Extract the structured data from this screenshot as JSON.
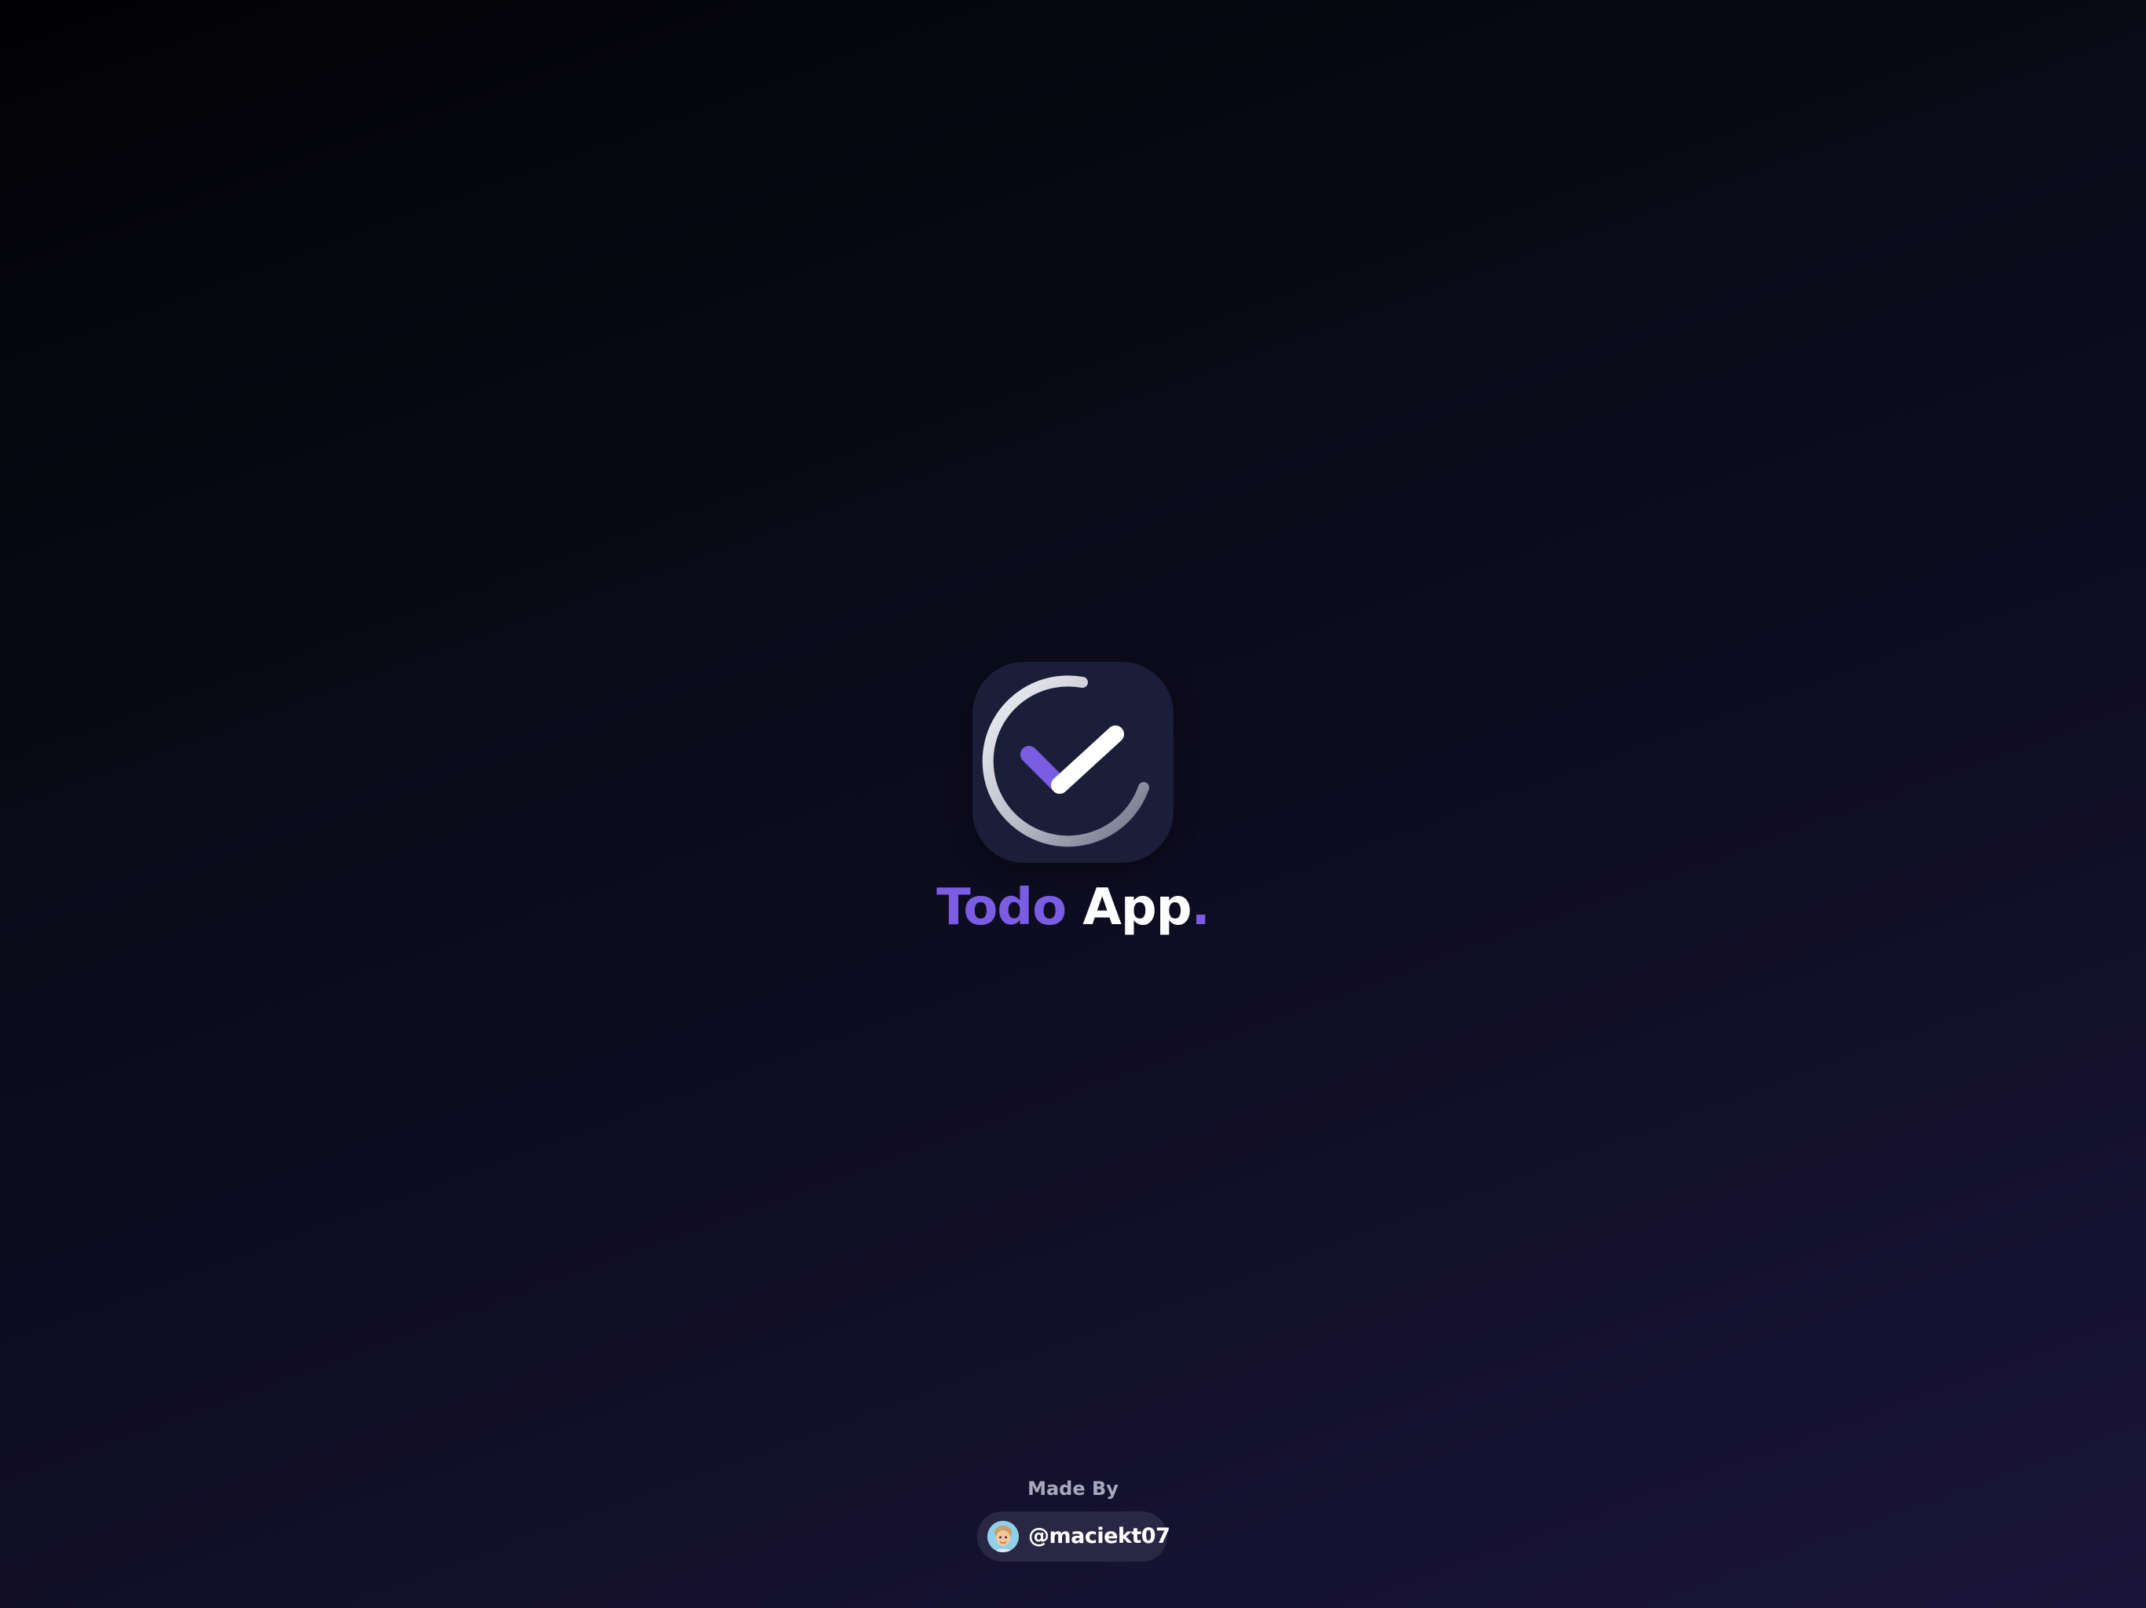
{
  "app": {
    "title_part1": "Todo",
    "title_part2": "App",
    "title_dot": "."
  },
  "logo": {
    "icon": "check-circle-icon"
  },
  "credit": {
    "label": "Made By",
    "handle": "@maciekt07",
    "avatar_icon": "avatar-memoji-icon"
  },
  "colors": {
    "accent": "#7a5de3",
    "tile_background": "#1b1e38",
    "background_dark": "#020205",
    "background_light": "#1a1538",
    "text_primary": "#ffffff",
    "text_muted": "#a9a7bd"
  }
}
